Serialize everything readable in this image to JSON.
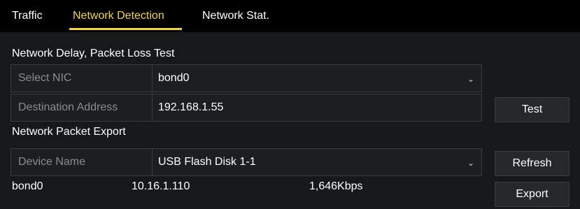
{
  "tabs": [
    {
      "label": "Traffic",
      "active": false
    },
    {
      "label": "Network Detection",
      "active": true
    },
    {
      "label": "Network Stat.",
      "active": false
    }
  ],
  "delay_test": {
    "title": "Network Delay, Packet Loss Test",
    "nic_label": "Select NIC",
    "nic_value": "bond0",
    "dest_label": "Destination Address",
    "dest_value": "192.168.1.55",
    "test_button": "Test"
  },
  "packet_export": {
    "title": "Network Packet Export",
    "device_label": "Device Name",
    "device_value": "USB Flash Disk 1-1",
    "refresh_button": "Refresh",
    "export_button": "Export"
  },
  "status_row": {
    "interface": "bond0",
    "ip": "10.16.1.110",
    "rate": "1,646Kbps"
  },
  "icons": {
    "dropdown": "chevron-down-icon"
  },
  "colors": {
    "accent": "#f2d635",
    "background": "#16181a",
    "tabbar": "#000000",
    "label_text": "#8a8d90"
  }
}
